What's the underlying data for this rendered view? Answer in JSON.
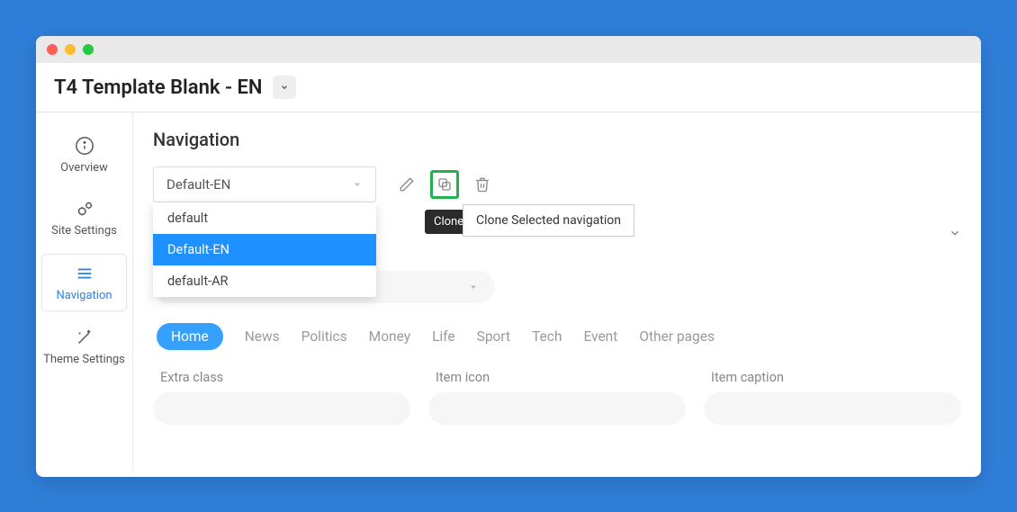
{
  "header": {
    "title": "T4 Template Blank - EN"
  },
  "sidebar": {
    "items": [
      {
        "label": "Overview"
      },
      {
        "label": "Site Settings"
      },
      {
        "label": "Navigation"
      },
      {
        "label": "Theme Settings"
      }
    ]
  },
  "page": {
    "title": "Navigation"
  },
  "nav_select": {
    "value": "Default-EN",
    "options": [
      "default",
      "Default-EN",
      "default-AR"
    ]
  },
  "toolbar": {
    "clone_badge": "Clone",
    "clone_tooltip": "Clone Selected navigation"
  },
  "tabs": [
    "Home",
    "News",
    "Politics",
    "Money",
    "Life",
    "Sport",
    "Tech",
    "Event",
    "Other pages"
  ],
  "fields": {
    "extra_class": "Extra class",
    "item_icon": "Item icon",
    "item_caption": "Item caption"
  }
}
